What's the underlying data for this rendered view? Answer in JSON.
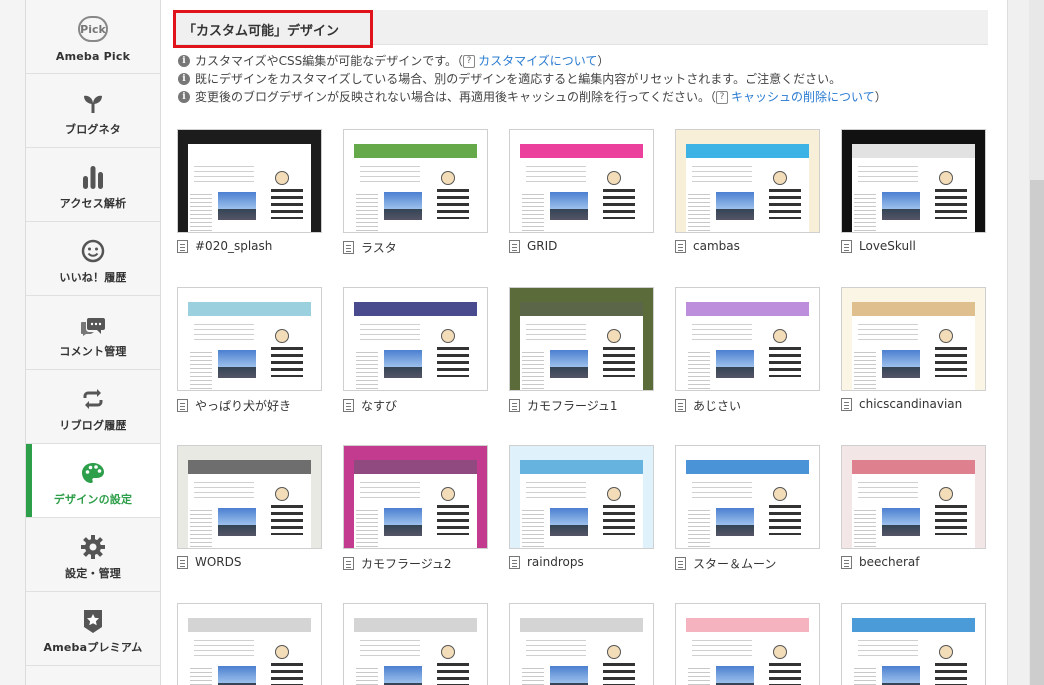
{
  "sidebar": {
    "items": [
      {
        "label": "Ameba Pick",
        "badge": "Pick",
        "icon": "pick-badge-icon"
      },
      {
        "label": "ブログネタ",
        "icon": "sprout-icon"
      },
      {
        "label": "アクセス解析",
        "icon": "bar-chart-icon"
      },
      {
        "label": "いいね！履歴",
        "icon": "smile-icon"
      },
      {
        "label": "コメント管理",
        "icon": "chat-bubbles-icon"
      },
      {
        "label": "リブログ履歴",
        "icon": "reblog-icon"
      },
      {
        "label": "デザインの設定",
        "icon": "palette-icon",
        "active": true
      },
      {
        "label": "設定・管理",
        "icon": "gear-icon"
      },
      {
        "label": "Amebaプレミアム",
        "icon": "premium-star-icon"
      }
    ]
  },
  "section": {
    "title": "「カスタム可能」デザイン"
  },
  "notes": {
    "n1_text": "カスタマイズやCSS編集が可能なデザインです。（",
    "n1_help": "?",
    "n1_link": "カスタマイズについて",
    "n1_close": "）",
    "n2_text": "既にデザインをカスタマイズしている場合、別のデザインを適応すると編集内容がリセットされます。ご注意ください。",
    "n3_text": "変更後のブログデザインが反映されない場合は、再適用後キャッシュの削除を行ってください。（",
    "n3_help": "?",
    "n3_link": "キャッシュの削除について",
    "n3_close": "）"
  },
  "designs": [
    {
      "name": "#020_splash",
      "bg": "#1c1c1c",
      "accent": "#ffffff"
    },
    {
      "name": "ラスタ",
      "bg": "#ffffff",
      "accent": "#4a9a2a"
    },
    {
      "name": "GRID",
      "bg": "#ffffff",
      "accent": "#e91e8c"
    },
    {
      "name": "cambas",
      "bg": "#f7efd8",
      "accent": "#1aa5e0"
    },
    {
      "name": "LoveSkull",
      "bg": "#111111",
      "accent": "#dddddd"
    },
    {
      "name": "やっぱり犬が好き",
      "bg": "#ffffff",
      "accent": "#8ac8d8"
    },
    {
      "name": "なすび",
      "bg": "#ffffff",
      "accent": "#2a2a7a"
    },
    {
      "name": "カモフラージュ1",
      "bg": "#5b6b3a",
      "accent": "#3e4a28"
    },
    {
      "name": "あじさい",
      "bg": "#ffffff",
      "accent": "#b27ad6"
    },
    {
      "name": "chicscandinavian",
      "bg": "#fbf5e6",
      "accent": "#d9b47a"
    },
    {
      "name": "WORDS",
      "bg": "#e9e9e4",
      "accent": "#555555"
    },
    {
      "name": "カモフラージュ2",
      "bg": "#c23b8f",
      "accent": "#7d2a6a"
    },
    {
      "name": "raindrops",
      "bg": "#dff1fb",
      "accent": "#4aa6d8"
    },
    {
      "name": "スター＆ムーン",
      "bg": "#ffffff",
      "accent": "#2a80d0"
    },
    {
      "name": "beecheraf",
      "bg": "#f3e6e6",
      "accent": "#d86a7a"
    },
    {
      "name": "",
      "bg": "#ffffff",
      "accent": "#cccccc"
    },
    {
      "name": "",
      "bg": "#ffffff",
      "accent": "#cccccc"
    },
    {
      "name": "",
      "bg": "#ffffff",
      "accent": "#cccccc"
    },
    {
      "name": "",
      "bg": "#ffffff",
      "accent": "#f2a6b4"
    },
    {
      "name": "",
      "bg": "#ffffff",
      "accent": "#2a8ad0"
    }
  ],
  "colors": {
    "active_green": "#2d9e49",
    "highlight_red": "#e0131a",
    "link_blue": "#2a7bd1"
  }
}
